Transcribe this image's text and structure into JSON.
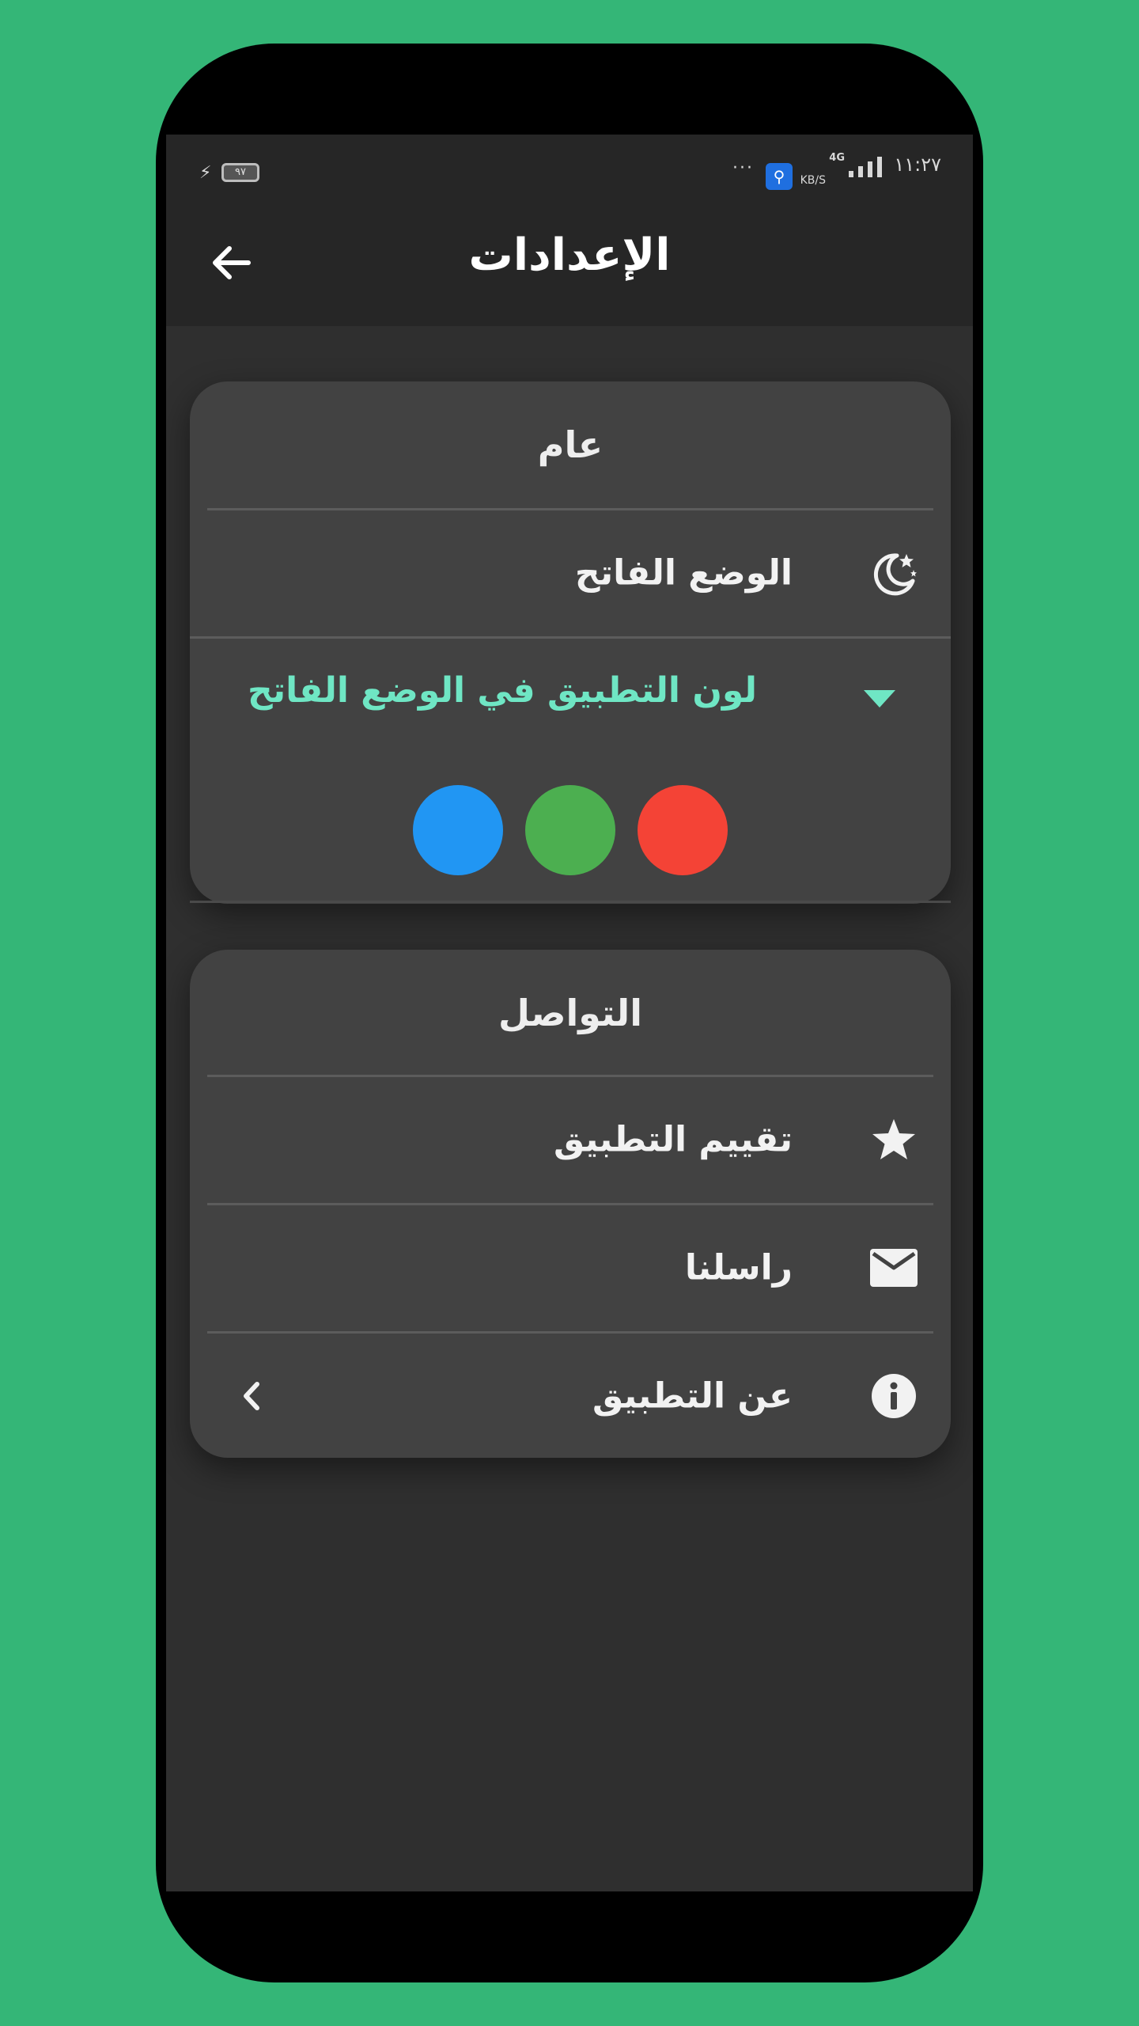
{
  "status_bar": {
    "time": "١١:٢٧",
    "network": "4G",
    "speed_unit": "KB/S",
    "more": "···",
    "battery": "٩٧",
    "charging_icon": "bolt-icon",
    "usb_icon": "usb-icon"
  },
  "app_bar": {
    "title": "الإعدادات",
    "back_icon": "arrow-left-icon"
  },
  "general": {
    "header": "عام",
    "light_mode": {
      "label": "الوضع الفاتح",
      "icon": "moon-star-icon"
    },
    "app_color": {
      "label": "لون التطبيق في الوضع الفاتح",
      "icon": "triangle-down-icon",
      "accent": "#6fe6c4",
      "swatches": [
        "#f44336",
        "#4caf50",
        "#2196f3"
      ]
    }
  },
  "contact": {
    "header": "التواصل",
    "rate": {
      "label": "تقييم التطبيق",
      "icon": "star-icon"
    },
    "message": {
      "label": "راسلنا",
      "icon": "mail-icon"
    },
    "about": {
      "label": "عن التطبيق",
      "icon": "info-icon",
      "chevron": "chevron-left-icon"
    }
  },
  "colors": {
    "background": "#34b677",
    "card": "#424242",
    "screen": "#2f2f2f"
  }
}
